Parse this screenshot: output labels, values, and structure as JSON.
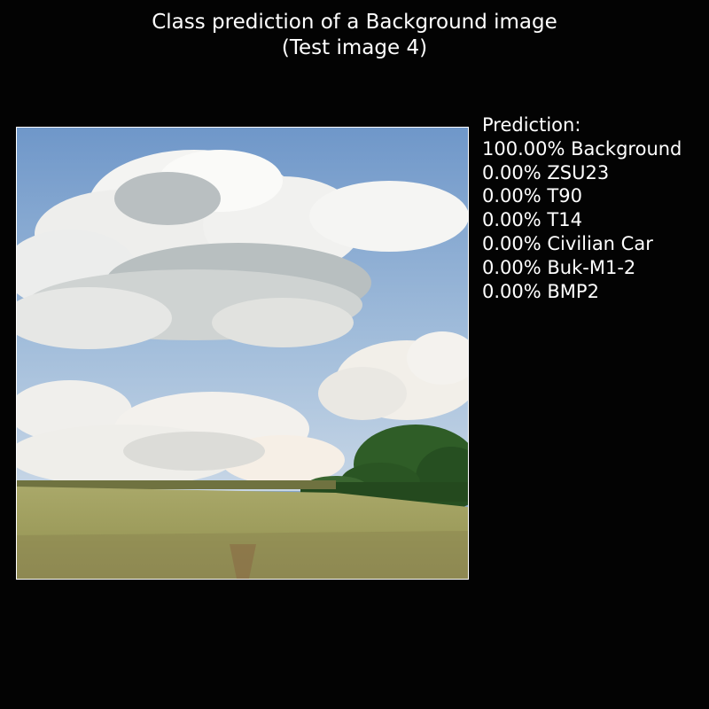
{
  "title": {
    "line1": "Class prediction of a Background image",
    "line2": "(Test image 4)"
  },
  "prediction": {
    "heading": "Prediction:",
    "classes": [
      {
        "label": "100.00% Background",
        "class": "Background",
        "probability": 100.0
      },
      {
        "label": "0.00% ZSU23",
        "class": "ZSU23",
        "probability": 0.0
      },
      {
        "label": "0.00% T90",
        "class": "T90",
        "probability": 0.0
      },
      {
        "label": "0.00% T14",
        "class": "T14",
        "probability": 0.0
      },
      {
        "label": "0.00% Civilian Car",
        "class": "Civilian Car",
        "probability": 0.0
      },
      {
        "label": "0.00% Buk-M1-2",
        "class": "Buk-M1-2",
        "probability": 0.0
      },
      {
        "label": "0.00% BMP2",
        "class": "BMP2",
        "probability": 0.0
      }
    ]
  },
  "colors": {
    "background": "#030303",
    "text": "#ffffff",
    "sky": "#86a6cc",
    "field": "#a7a66a",
    "trees": "#2c5a24"
  }
}
